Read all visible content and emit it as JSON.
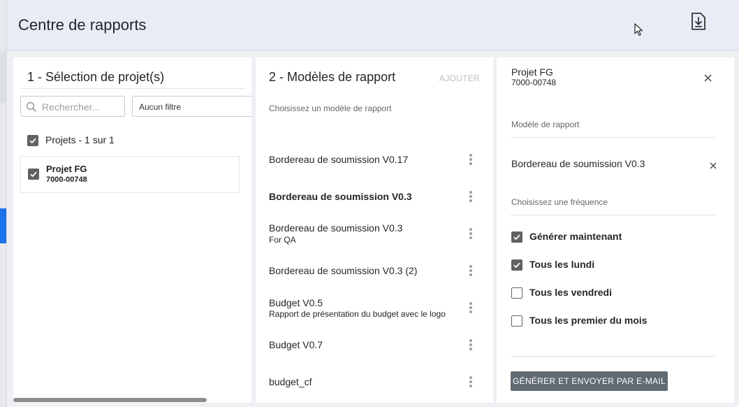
{
  "header": {
    "title": "Centre de rapports",
    "download_icon": "download-file-icon"
  },
  "projects_panel": {
    "title": "1 - Sélection de projet(s)",
    "search_placeholder": "Rechercher...",
    "filter_value": "Aucun filtre",
    "select_all_label": "Projets - 1 sur 1",
    "select_all_checked": true,
    "projects": [
      {
        "name": "Projet FG",
        "code": "7000-00748",
        "checked": true
      }
    ]
  },
  "templates_panel": {
    "title": "2 - Modèles de rapport",
    "add_label": "AJOUTER",
    "subtitle": "Choisissez un modèle de rapport",
    "templates": [
      {
        "name": "Bordereau de soumission V0.17",
        "desc": "",
        "bold": false
      },
      {
        "name": "Bordereau de soumission V0.3",
        "desc": "",
        "bold": true
      },
      {
        "name": "Bordereau de soumission V0.3",
        "desc": "For QA",
        "bold": false
      },
      {
        "name": "Bordereau de soumission V0.3 (2)",
        "desc": "",
        "bold": false
      },
      {
        "name": "Budget V0.5",
        "desc": "Rapport de présentation du budget avec le logo",
        "bold": false
      },
      {
        "name": "Budget V0.7",
        "desc": "",
        "bold": false
      },
      {
        "name": "budget_cf",
        "desc": "",
        "bold": false
      }
    ]
  },
  "details_panel": {
    "project_name": "Projet FG",
    "project_code": "7000-00748",
    "template_label": "Modèle de rapport",
    "selected_template": "Bordereau de soumission V0.3",
    "frequency_label": "Choisissez une fréquence",
    "frequencies": [
      {
        "label": "Générer maintenant",
        "checked": true
      },
      {
        "label": "Tous les lundi",
        "checked": true
      },
      {
        "label": "Tous les vendredi",
        "checked": false
      },
      {
        "label": "Tous les premier du mois",
        "checked": false
      }
    ],
    "send_button": "GÉNÉRER ET ENVOYER PAR E-MAIL"
  },
  "colors": {
    "accent": "#1a73e8",
    "checkbox": "#616161",
    "button": "#616a73"
  }
}
